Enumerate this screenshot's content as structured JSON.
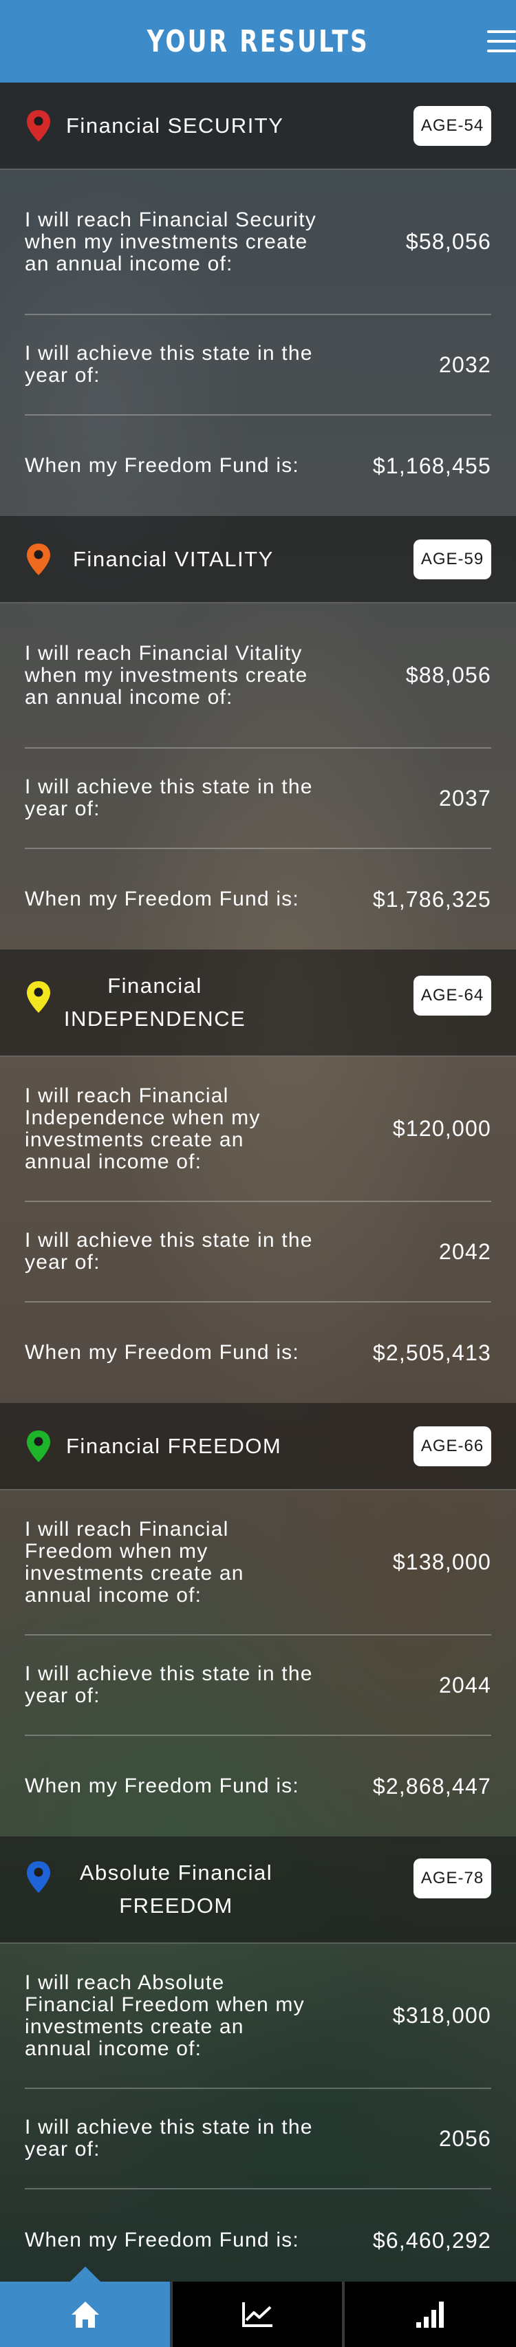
{
  "header": {
    "title": "YOUR RESULTS",
    "menu_icon": "hamburger-menu-icon"
  },
  "colors": {
    "header_blue": "#3d8cc9",
    "badge_bg": "#ffffff",
    "tab_inactive": "#000000"
  },
  "sections": [
    {
      "pin_color": "#d42a2a",
      "pin_icon": "map-pin-icon",
      "title": "Financial SECURITY",
      "age": "AGE-54",
      "income_label": "I will reach Financial Security when my investments create an annual income of:",
      "income_value": "$58,056",
      "year_label": "I will achieve this state in the year of:",
      "year_value": "2032",
      "fund_label": "When my Freedom Fund is:",
      "fund_value": "$1,168,455"
    },
    {
      "pin_color": "#ee6a1e",
      "pin_icon": "map-pin-icon",
      "title": "Financial VITALITY",
      "age": "AGE-59",
      "income_label": "I will reach Financial Vitality when my investments create an annual income of:",
      "income_value": "$88,056",
      "year_label": "I will achieve this state in the year of:",
      "year_value": "2037",
      "fund_label": "When my Freedom Fund is:",
      "fund_value": "$1,786,325"
    },
    {
      "pin_color": "#f4e61e",
      "pin_icon": "map-pin-icon",
      "title": "Financial INDEPENDENCE",
      "age": "AGE-64",
      "income_label": "I will reach Financial Independence when my investments create an annual income of:",
      "income_value": "$120,000",
      "year_label": "I will achieve this state in the year of:",
      "year_value": "2042",
      "fund_label": "When my Freedom Fund is:",
      "fund_value": "$2,505,413"
    },
    {
      "pin_color": "#1fb52a",
      "pin_icon": "map-pin-icon",
      "title": "Financial FREEDOM",
      "age": "AGE-66",
      "income_label": "I will reach Financial Freedom when my investments create an annual income of:",
      "income_value": "$138,000",
      "year_label": "I will achieve this state in the year of:",
      "year_value": "2044",
      "fund_label": "When my Freedom Fund is:",
      "fund_value": "$2,868,447"
    },
    {
      "pin_color": "#1f63d8",
      "pin_icon": "map-pin-icon",
      "title": "Absolute Financial FREEDOM",
      "age": "AGE-78",
      "income_label": "I will reach Absolute Financial Freedom when my investments create an annual income of:",
      "income_value": "$318,000",
      "year_label": "I will achieve this state in the year of:",
      "year_value": "2056",
      "fund_label": "When my Freedom Fund is:",
      "fund_value": "$6,460,292"
    }
  ],
  "tabbar": {
    "tabs": [
      {
        "icon": "home-icon",
        "active": true
      },
      {
        "icon": "line-chart-icon",
        "active": false
      },
      {
        "icon": "bar-signal-icon",
        "active": false
      }
    ]
  }
}
